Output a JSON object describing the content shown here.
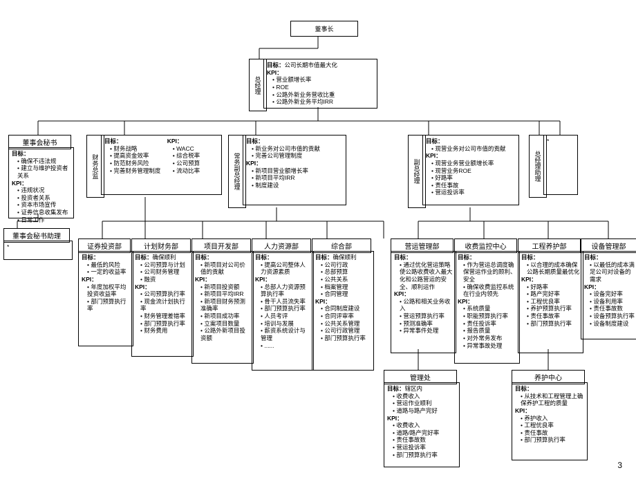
{
  "page_number": "3",
  "top": {
    "chairman": "董事长",
    "gm_label": "总经理",
    "gm_goal_label": "目标：",
    "gm_goal": "公司长期市值最大化",
    "gm_kpi_label": "KPI：",
    "gm_kpis": [
      "营业额增长率",
      "ROE",
      "公路外新业务营收比重",
      "公路外新业务平均IRR"
    ]
  },
  "level2": {
    "secretary": {
      "title": "董事会秘书",
      "goal_label": "目标：",
      "goals": [
        "确保不违法规",
        "建立与维护投资者关系"
      ],
      "kpi_label": "KPI：",
      "kpis": [
        "违规状况",
        "投资者关系",
        "资本市场宣传",
        "证券信息收集发布",
        "日常工作"
      ]
    },
    "cfo_label": "财务总监",
    "cfo": {
      "goal_label": "目标：",
      "goals": [
        "财务战略",
        "提高资金效率",
        "防范财务风险",
        "完善财务管理制度"
      ],
      "kpi_label": "KPI：",
      "kpis": [
        "WACC",
        "综合税率",
        "公司预算",
        "流动比率"
      ]
    },
    "evp_label": "常务副总经理",
    "evp": {
      "goal_label": "目标：",
      "goals": [
        "新业务对公司市值的贡献",
        "完善公司管理制度"
      ],
      "kpi_label": "KPI：",
      "kpis": [
        "新项目营业额增长率",
        "新项目平均IRR",
        "制度建设"
      ]
    },
    "vp_label": "副总经理",
    "vp": {
      "goal_label": "目标：",
      "goals": [
        "现营业务对公司市值的贡献"
      ],
      "kpi_label": "KPI：",
      "kpis": [
        "现营业务营业额增长率",
        "现营业务ROE",
        "好路率",
        "责任事故",
        "营运投诉率"
      ]
    },
    "assistant_label": "总经理助理",
    "assistant_note": "*"
  },
  "sec_assistant": {
    "title": "董事会秘书助理",
    "note": "*"
  },
  "depts": {
    "d1": {
      "title": "证券投资部",
      "goal_label": "目标：",
      "goals": [
        "最低的风险",
        "一定的收益率"
      ],
      "kpi_label": "KPI：",
      "kpis": [
        "年度加权平均投资收益率",
        "部门预算执行率"
      ]
    },
    "d2": {
      "title": "计划财务部",
      "goal_label": "目标：",
      "goal_inline": "确保顺利",
      "goals": [
        "公司预算与计划",
        "公司财务管理",
        "融资"
      ],
      "kpi_label": "KPI：",
      "kpis": [
        "公司预算执行率",
        "现金流计划执行率",
        "财务管理差错率",
        "部门预算执行率",
        "财务费用"
      ]
    },
    "d3": {
      "title": "项目开发部",
      "goal_label": "目标：",
      "goals": [
        "新项目对公司价值的贡献"
      ],
      "kpi_label": "KPI：",
      "kpis": [
        "新项目投资额",
        "新项目平均IRR",
        "新项目财务预测准确率",
        "新项目成功率",
        "立案项目数量",
        "公路外新项目投资额"
      ]
    },
    "d4": {
      "title": "人力资源部",
      "goal_label": "目标：",
      "goals": [
        "提高公司整体人力资源素质"
      ],
      "kpi_label": "KPI：",
      "kpis": [
        "总部人力资源预算执行率",
        "骨干人员流失率",
        "部门预算执行率",
        "人员考评",
        "培训与发展",
        "薪资系统设计与管理",
        "......"
      ]
    },
    "d5": {
      "title": "综合部",
      "goal_label": "目标：",
      "goal_inline": "确保顺利",
      "goals": [
        "公司行政",
        "总部预算",
        "公共关系",
        "档案管理",
        "合同管理"
      ],
      "kpi_label": "KPI：",
      "kpis": [
        "合同制度建设",
        "合同评审率",
        "公共关系管理",
        "公司行政管理",
        "部门预算执行率"
      ]
    },
    "d6": {
      "title": "营运管理部",
      "goal_label": "目标：",
      "goals": [
        "通过优化营运策略使公路收费收入最大化和公路营运的安全、顺利运作"
      ],
      "kpi_label": "KPI：",
      "kpis": [
        "公路和相关业务收入",
        "营运预算执行率",
        "预测准确率",
        "异常事件处理"
      ]
    },
    "d7": {
      "title": "收费监控中心",
      "goal_label": "目标：",
      "goals": [
        "作为营运总调度确保营运作业的顾利、安全",
        "确保收费监控系统在行业内领先"
      ],
      "kpi_label": "KPI：",
      "kpis": [
        "系统质量",
        "职能预算执行率",
        "责任投诉率",
        "报告质量",
        "对外常务发布",
        "异常事故处理"
      ]
    },
    "d8": {
      "title": "工程养护部",
      "goal_label": "目标：",
      "goals": [
        "以合理的成本确保公路长期质量最优化"
      ],
      "kpi_label": "KPI：",
      "kpis": [
        "好路率",
        "路产完好率",
        "工程优良率",
        "养护预算执行率",
        "责任事故率",
        "部门预算执行率"
      ]
    },
    "d9": {
      "title": "设备管理部",
      "goal_label": "目标：",
      "goals": [
        "以最低的成本满足公司对设备的需求"
      ],
      "kpi_label": "KPI：",
      "kpis": [
        "设备完好率",
        "设备利用率",
        "责任事故数",
        "设备预算执行率",
        "设备制度建设"
      ]
    }
  },
  "bottom": {
    "mgmt": {
      "title": "管理处",
      "goal_label": "目标：",
      "goal_inline": "辖区内",
      "goals": [
        "收费收入",
        "营运作业顺利",
        "道路与路产完好"
      ],
      "kpi_label": "KPI：",
      "kpis": [
        "收费收入",
        "道路/路产完好率",
        "责任事故数",
        "营运投诉率",
        "部门预算执行率"
      ]
    },
    "maint": {
      "title": "养护中心",
      "goal_label": "目标：",
      "goals": [
        "从技术和工程管理上确保养护工程的质量"
      ],
      "kpi_label": "KPI：",
      "kpis": [
        "养护收入",
        "工程优良率",
        "责任事故",
        "部门预算执行率"
      ]
    }
  }
}
